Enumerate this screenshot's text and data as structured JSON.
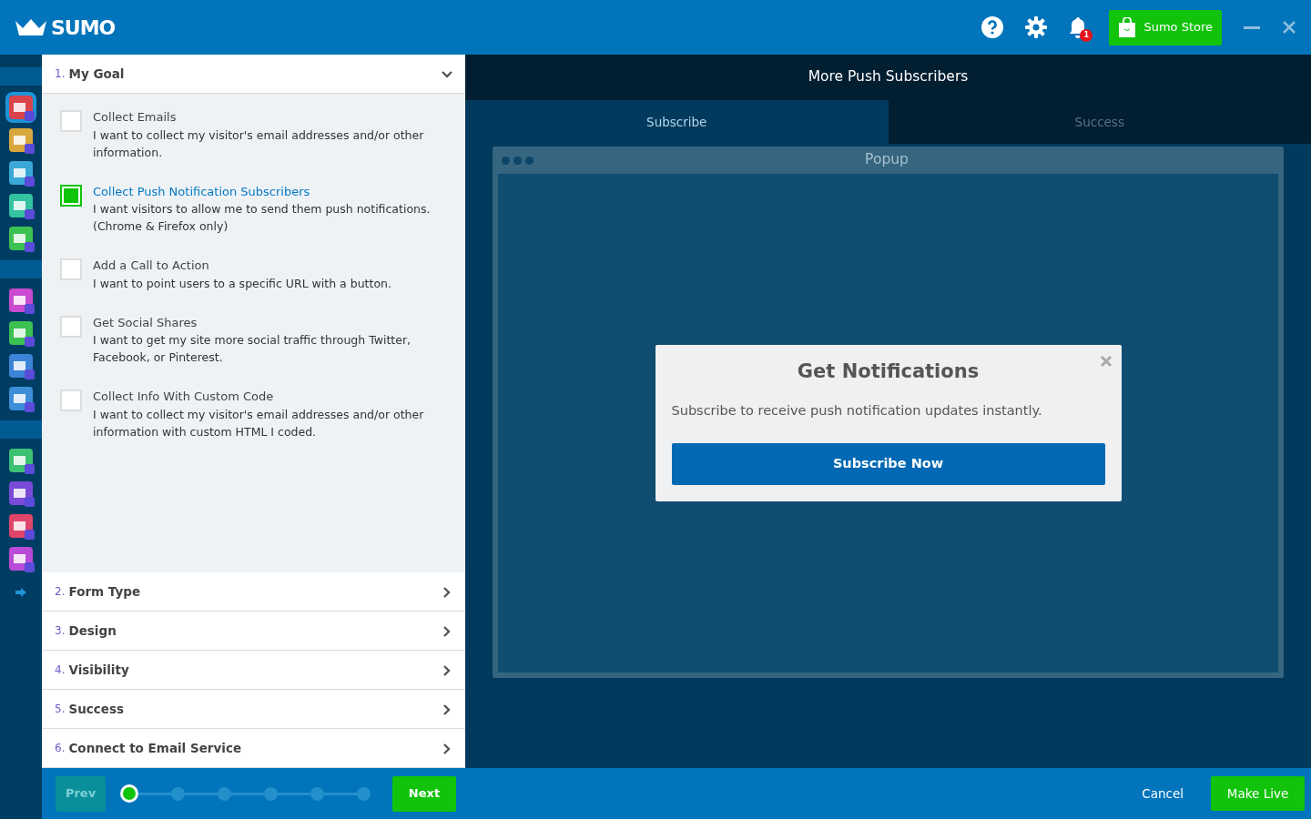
{
  "header": {
    "logo": "SUMO",
    "notifications_badge": "1",
    "store_button": "Sumo Store"
  },
  "sidebar": {
    "groups": [
      {
        "apps": [
          {
            "color": "#d9434b",
            "selected": true
          },
          {
            "color": "#d9a83c",
            "selected": false
          },
          {
            "color": "#3aa8d8",
            "selected": false
          },
          {
            "color": "#33c3a0",
            "selected": false
          },
          {
            "color": "#3cc153",
            "selected": false
          }
        ]
      },
      {
        "apps": [
          {
            "color": "#c84bd0",
            "selected": false
          },
          {
            "color": "#3cc153",
            "selected": false
          },
          {
            "color": "#3c84d8",
            "selected": false
          },
          {
            "color": "#3c8ed8",
            "selected": false
          }
        ]
      },
      {
        "apps": [
          {
            "color": "#3cc173",
            "selected": false
          },
          {
            "color": "#7a4bd8",
            "selected": false
          },
          {
            "color": "#e0456a",
            "selected": false
          },
          {
            "color": "#b84bd8",
            "selected": false
          }
        ]
      }
    ]
  },
  "steps": [
    {
      "number": "1.",
      "title": "My Goal",
      "expanded": true,
      "options": [
        {
          "title": "Collect Emails",
          "description": "I want to collect my visitor's email addresses and/or other information.",
          "checked": false
        },
        {
          "title": "Collect Push Notification Subscribers",
          "description": "I want visitors to allow me to send them push notifications. (Chrome & Firefox only)",
          "checked": true
        },
        {
          "title": "Add a Call to Action",
          "description": "I want to point users to a specific URL with a button.",
          "checked": false
        },
        {
          "title": "Get Social Shares",
          "description": "I want to get my site more social traffic through Twitter, Facebook, or Pinterest.",
          "checked": false
        },
        {
          "title": "Collect Info With Custom Code",
          "description": "I want to collect my visitor's email addresses and/or other information with custom HTML I coded.",
          "checked": false
        }
      ]
    },
    {
      "number": "2.",
      "title": "Form Type",
      "expanded": false
    },
    {
      "number": "3.",
      "title": "Design",
      "expanded": false
    },
    {
      "number": "4.",
      "title": "Visibility",
      "expanded": false
    },
    {
      "number": "5.",
      "title": "Success",
      "expanded": false
    },
    {
      "number": "6.",
      "title": "Connect to Email Service",
      "expanded": false
    }
  ],
  "wizard_nav": {
    "prev": "Prev",
    "prev_disabled": true,
    "next": "Next",
    "dots": [
      {
        "selected": true
      },
      {
        "selected": false
      },
      {
        "selected": false
      },
      {
        "selected": false
      },
      {
        "selected": false
      },
      {
        "selected": false
      }
    ]
  },
  "preview": {
    "title": "More Push Subscribers",
    "tabs": [
      {
        "label": "Subscribe",
        "selected": true
      },
      {
        "label": "Success",
        "selected": false
      }
    ],
    "window_title": "Popup",
    "popup": {
      "heading": "Get Notifications",
      "text": "Subscribe to receive push notification updates instantly.",
      "button": "Subscribe Now"
    }
  },
  "footer": {
    "cancel": "Cancel",
    "make_live": "Make Live"
  }
}
